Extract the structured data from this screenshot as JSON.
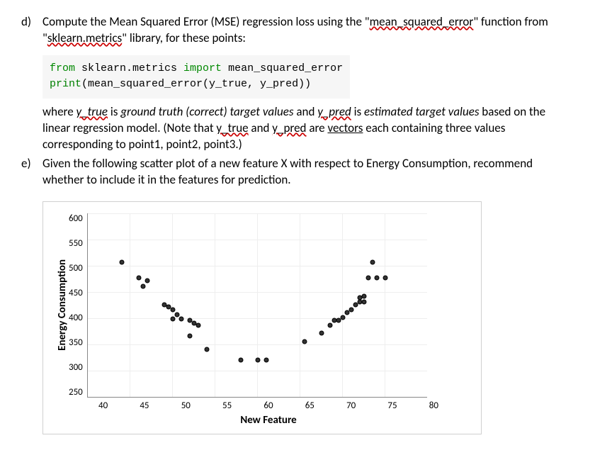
{
  "questions": {
    "d": {
      "letter": "d)",
      "text_prefix": "Compute the Mean Squared Error (MSE) regression loss using the \"",
      "mse_func": "mean_squared_error",
      "text_mid1": "\" function from \"",
      "sklearn_lib": "sklearn.metrics",
      "text_suffix": "\" library, for these points:"
    },
    "code": {
      "kw_from": "from",
      "module": " sklearn.metrics ",
      "kw_import": "import",
      "func": " mean_squared_error",
      "kw_print": "print",
      "call": "(mean_squared_error(y_true, y_pred))"
    },
    "d_cont": {
      "t1": "where ",
      "ytrue": "y_true",
      "t2": " is ",
      "gt": "ground truth (correct) target values",
      "t3": " and ",
      "ypred": "y_pred",
      "t4": " is ",
      "est": "estimated target values",
      "t5": " based on the linear regression model. (Note that ",
      "ytrue2": "y_true",
      "t6": " and ",
      "ypred2": "y_pred",
      "t7": " are ",
      "vectors": "vectors",
      "t8": " each containing three values corresponding to point1, point2, point3.)"
    },
    "e": {
      "letter": "e)",
      "text": "Given the following scatter plot of a new feature X with respect to Energy Consumption, recommend whether to include it in the features for prediction."
    }
  },
  "chart_data": {
    "type": "scatter",
    "xlabel": "New Feature",
    "ylabel": "Energy Consumption",
    "xlim": [
      40,
      80
    ],
    "ylim": [
      250,
      600
    ],
    "xticks": [
      "40",
      "45",
      "50",
      "55",
      "60",
      "65",
      "70",
      "75",
      "80"
    ],
    "yticks": [
      "600",
      "550",
      "500",
      "450",
      "400",
      "350",
      "300",
      "250"
    ],
    "points": [
      {
        "x": 44,
        "y": 505
      },
      {
        "x": 46,
        "y": 475
      },
      {
        "x": 47,
        "y": 470
      },
      {
        "x": 46.5,
        "y": 460
      },
      {
        "x": 49,
        "y": 425
      },
      {
        "x": 49.5,
        "y": 420
      },
      {
        "x": 50,
        "y": 415
      },
      {
        "x": 50.5,
        "y": 405
      },
      {
        "x": 50,
        "y": 398
      },
      {
        "x": 51,
        "y": 398
      },
      {
        "x": 52,
        "y": 395
      },
      {
        "x": 52.5,
        "y": 390
      },
      {
        "x": 53,
        "y": 385
      },
      {
        "x": 52,
        "y": 365
      },
      {
        "x": 54,
        "y": 340
      },
      {
        "x": 58,
        "y": 320
      },
      {
        "x": 60,
        "y": 320
      },
      {
        "x": 61,
        "y": 320
      },
      {
        "x": 65.5,
        "y": 355
      },
      {
        "x": 67.5,
        "y": 370
      },
      {
        "x": 68.5,
        "y": 385
      },
      {
        "x": 69,
        "y": 395
      },
      {
        "x": 69.5,
        "y": 395
      },
      {
        "x": 70,
        "y": 400
      },
      {
        "x": 70.5,
        "y": 410
      },
      {
        "x": 71,
        "y": 415
      },
      {
        "x": 71.5,
        "y": 425
      },
      {
        "x": 72,
        "y": 430
      },
      {
        "x": 72,
        "y": 438
      },
      {
        "x": 72.5,
        "y": 430
      },
      {
        "x": 72.5,
        "y": 440
      },
      {
        "x": 73,
        "y": 475
      },
      {
        "x": 74,
        "y": 475
      },
      {
        "x": 75,
        "y": 475
      },
      {
        "x": 73.5,
        "y": 505
      }
    ]
  }
}
